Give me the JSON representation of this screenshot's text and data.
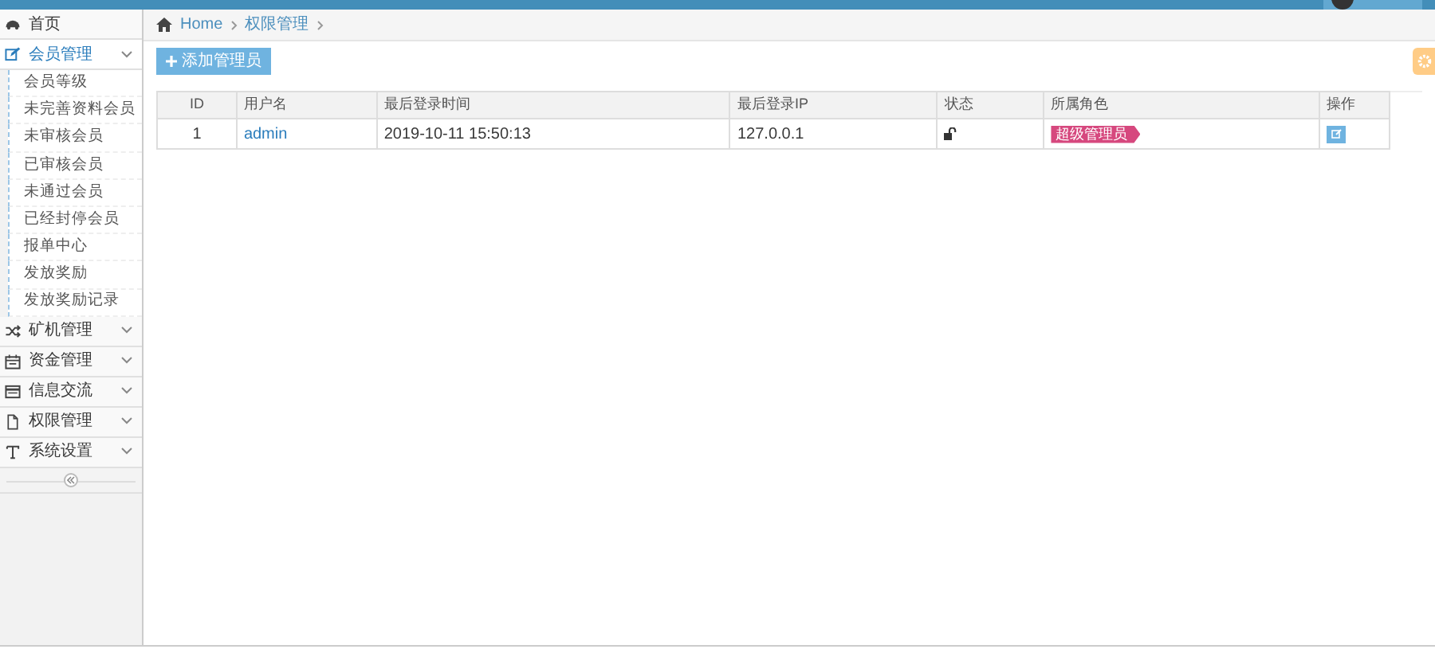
{
  "breadcrumb": [
    "Home",
    "权限管理"
  ],
  "sidebar": {
    "items": [
      {
        "kind": "link",
        "label": "首页",
        "expanded": false
      },
      {
        "kind": "menu",
        "label": "会员管理",
        "expanded": true,
        "children": [
          {
            "label": "会员等级"
          },
          {
            "label": "未完善资料会员"
          },
          {
            "label": "未审核会员"
          },
          {
            "label": "已审核会员"
          },
          {
            "label": "未通过会员"
          },
          {
            "label": "已经封停会员"
          },
          {
            "label": "报单中心"
          },
          {
            "label": "发放奖励"
          },
          {
            "label": "发放奖励记录"
          }
        ]
      },
      {
        "kind": "menu",
        "label": "矿机管理",
        "expanded": false
      },
      {
        "kind": "menu",
        "label": "资金管理",
        "expanded": false
      },
      {
        "kind": "menu",
        "label": "信息交流",
        "expanded": false
      },
      {
        "kind": "menu",
        "label": "权限管理",
        "expanded": false
      },
      {
        "kind": "menu",
        "label": "系统设置",
        "expanded": false
      }
    ]
  },
  "add_button": "添加管理员",
  "table": {
    "columns": [
      "ID",
      "用户名",
      "最后登录时间",
      "最后登录IP",
      "状态",
      "所属角色",
      "操作"
    ],
    "rows": [
      {
        "id": "1",
        "username": "admin",
        "last_login": "2019-10-11 15:50:13",
        "ip": "127.0.0.1",
        "locked": false,
        "role": "超级管理员"
      }
    ]
  }
}
